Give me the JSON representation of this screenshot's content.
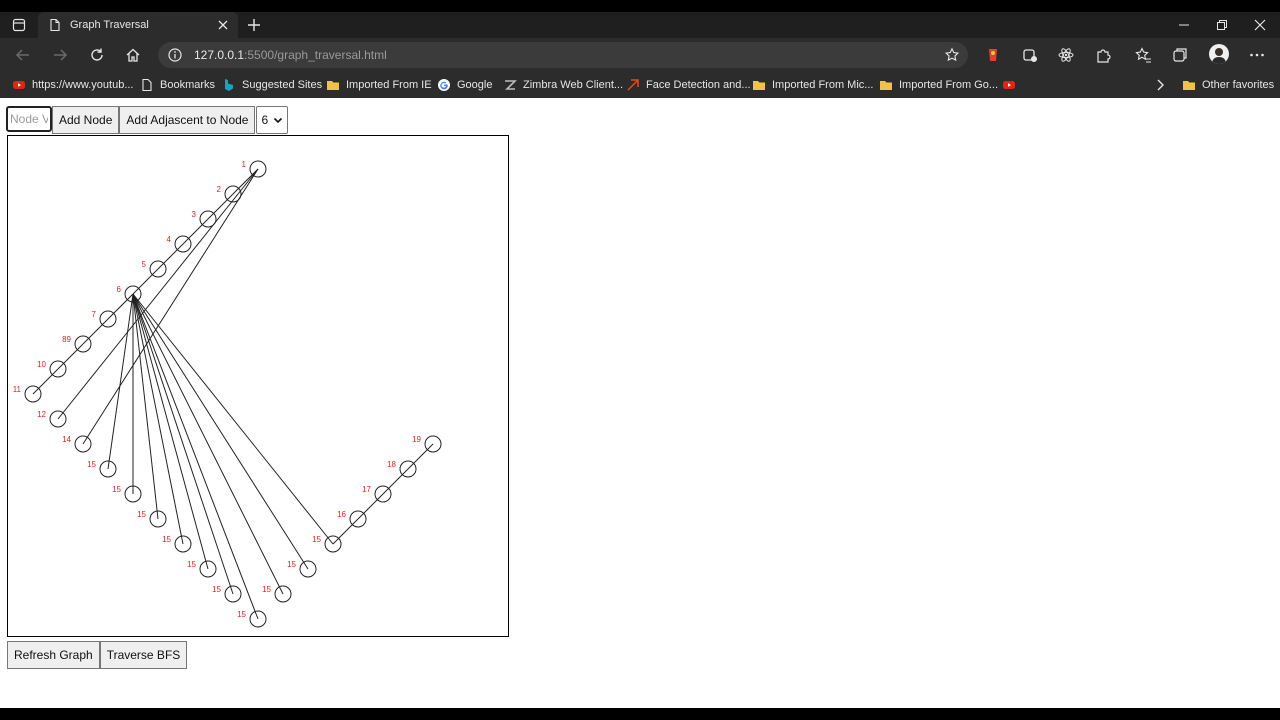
{
  "browser": {
    "tab_title": "Graph Traversal",
    "url_host": "127.0.0.1",
    "url_rest": ":5500/graph_traversal.html"
  },
  "bookmarks": [
    {
      "label": "https://www.youtub...",
      "icon": "youtube-icon"
    },
    {
      "label": "Bookmarks",
      "icon": "page-icon"
    },
    {
      "label": "Suggested Sites",
      "icon": "bing-icon"
    },
    {
      "label": "Imported From IE",
      "icon": "folder-icon"
    },
    {
      "label": "Google",
      "icon": "google-icon"
    },
    {
      "label": "Zimbra Web Client...",
      "icon": "zimbra-icon"
    },
    {
      "label": "Face Detection and...",
      "icon": "link-icon"
    },
    {
      "label": "Imported From Mic...",
      "icon": "folder-icon"
    },
    {
      "label": "Imported From Go...",
      "icon": "folder-icon"
    },
    {
      "label": "",
      "icon": "youtube-icon"
    }
  ],
  "bookmarks_other": "Other favorites",
  "controls": {
    "input_placeholder": "Node Value",
    "add_node": "Add Node",
    "add_adjacent": "Add Adjascent to Node",
    "select_value": "6"
  },
  "graph": {
    "nodes": [
      {
        "id": "1",
        "label": "1"
      },
      {
        "id": "2",
        "label": "2"
      },
      {
        "id": "3",
        "label": "3"
      },
      {
        "id": "4",
        "label": "4"
      },
      {
        "id": "5",
        "label": "5"
      },
      {
        "id": "6",
        "label": "6"
      },
      {
        "id": "7",
        "label": "7"
      },
      {
        "id": "89",
        "label": "89"
      },
      {
        "id": "10",
        "label": "10"
      },
      {
        "id": "11",
        "label": "11"
      },
      {
        "id": "12",
        "label": "12"
      },
      {
        "id": "14",
        "label": "14"
      },
      {
        "id": "15a",
        "label": "15"
      },
      {
        "id": "15b",
        "label": "15"
      },
      {
        "id": "15c",
        "label": "15"
      },
      {
        "id": "15d",
        "label": "15"
      },
      {
        "id": "15e",
        "label": "15"
      },
      {
        "id": "15f",
        "label": "15"
      },
      {
        "id": "15g",
        "label": "15"
      },
      {
        "id": "15h",
        "label": "15"
      },
      {
        "id": "15i",
        "label": "15"
      },
      {
        "id": "15j",
        "label": "15"
      },
      {
        "id": "16",
        "label": "16"
      },
      {
        "id": "17",
        "label": "17"
      },
      {
        "id": "18",
        "label": "18"
      },
      {
        "id": "19",
        "label": "19"
      }
    ],
    "edges": [
      [
        "1",
        "2"
      ],
      [
        "2",
        "3"
      ],
      [
        "3",
        "4"
      ],
      [
        "4",
        "5"
      ],
      [
        "5",
        "6"
      ],
      [
        "6",
        "7"
      ],
      [
        "7",
        "89"
      ],
      [
        "89",
        "10"
      ],
      [
        "10",
        "11"
      ],
      [
        "1",
        "12"
      ],
      [
        "1",
        "14"
      ],
      [
        "6",
        "15a"
      ],
      [
        "6",
        "15b"
      ],
      [
        "6",
        "15c"
      ],
      [
        "6",
        "15d"
      ],
      [
        "6",
        "15e"
      ],
      [
        "6",
        "15f"
      ],
      [
        "6",
        "15g"
      ],
      [
        "6",
        "15h"
      ],
      [
        "6",
        "15i"
      ],
      [
        "6",
        "15j"
      ],
      [
        "15j",
        "16"
      ],
      [
        "16",
        "17"
      ],
      [
        "17",
        "18"
      ],
      [
        "18",
        "19"
      ]
    ]
  },
  "bottom": {
    "refresh": "Refresh Graph",
    "traverse": "Traverse BFS"
  }
}
